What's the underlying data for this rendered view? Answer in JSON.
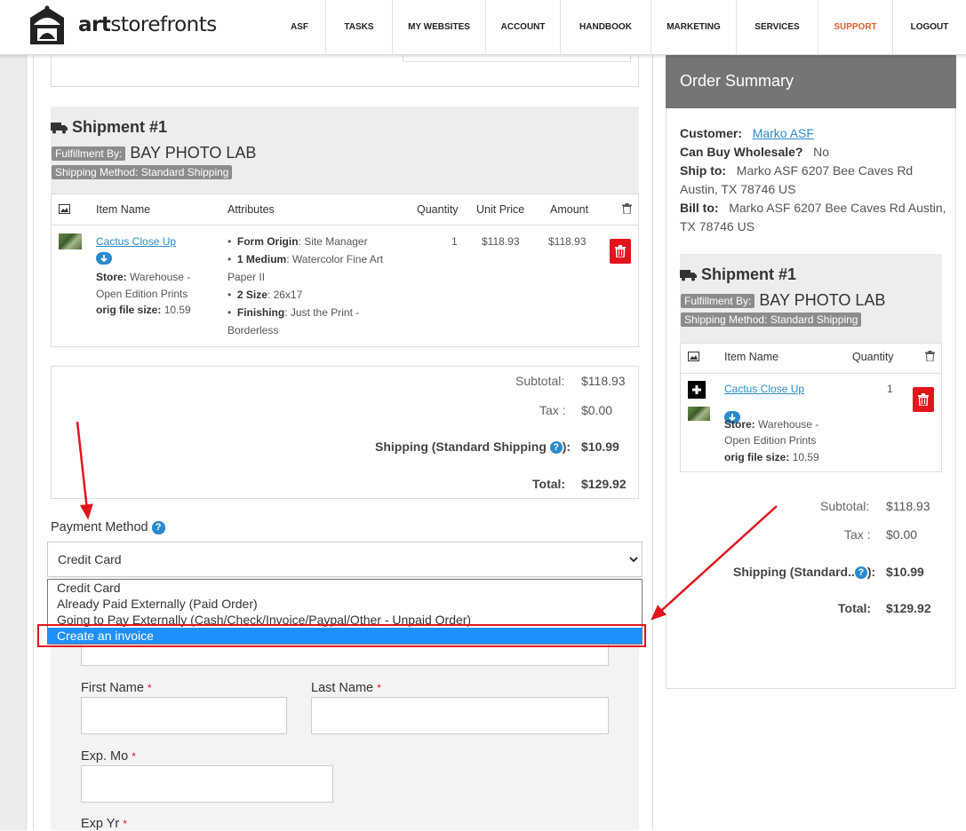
{
  "nav": {
    "logo_part1": "art",
    "logo_part2": "storefronts",
    "items": [
      {
        "label": "ASF"
      },
      {
        "label": "TASKS"
      },
      {
        "label": "MY WEBSITES"
      },
      {
        "label": "ACCOUNT"
      },
      {
        "label": "HANDBOOK"
      },
      {
        "label": "MARKETING"
      },
      {
        "label": "SERVICES"
      },
      {
        "label": "SUPPORT"
      },
      {
        "label": "LOGOUT"
      }
    ],
    "support_color": "#e4602b"
  },
  "shipment": {
    "title": "Shipment #1",
    "fulfillment_tag": "Fulfillment By:",
    "fulfillment_lab": "BAY PHOTO LAB",
    "shipping_method_tag": "Shipping Method: Standard Shipping",
    "columns": {
      "item_name": "Item Name",
      "attributes": "Attributes",
      "quantity": "Quantity",
      "unit_price": "Unit Price",
      "amount": "Amount"
    },
    "item": {
      "name": "Cactus Close Up",
      "store_label": "Store:",
      "store_value": "Warehouse -",
      "store_value2": "Open Edition Prints",
      "orig_label": "orig file size:",
      "orig_value": "10.59",
      "attributes": [
        {
          "key": "Form Origin",
          "value": ": Site Manager"
        },
        {
          "key": "1 Medium",
          "value": ": Watercolor Fine Art"
        },
        {
          "key": "",
          "value": "Paper II"
        },
        {
          "key": "2 Size",
          "value": ": 26x17"
        },
        {
          "key": "Finishing",
          "value": ": Just the Print -"
        },
        {
          "key": "",
          "value": "Borderless"
        }
      ],
      "quantity": "1",
      "unit_price": "$118.93",
      "amount": "$118.93"
    }
  },
  "totals": {
    "subtotal_label": "Subtotal:",
    "subtotal": "$118.93",
    "tax_label": "Tax :",
    "tax": "$0.00",
    "shipping_label": "Shipping (Standard Shipping",
    "shipping_suffix": "):",
    "shipping": "$10.99",
    "total_label": "Total:",
    "total": "$129.92"
  },
  "payment": {
    "label": "Payment Method",
    "selected": "Credit Card",
    "options": [
      "Credit Card",
      "Already Paid Externally (Paid Order)",
      "Going to Pay Externally (Cash/Check/Invoice/Paypal/Other - Unpaid Order)",
      "Create an invoice"
    ],
    "highlight_index": 3
  },
  "form": {
    "first_name": "First Name",
    "last_name": "Last Name",
    "exp_mo": "Exp. Mo",
    "exp_yr": "Exp Yr",
    "required_mark": "*"
  },
  "summary": {
    "title": "Order Summary",
    "customer_label": "Customer:",
    "customer": "Marko ASF",
    "wholesale_label": "Can Buy Wholesale?",
    "wholesale": "No",
    "ship_to_label": "Ship to:",
    "ship_to_line1": "Marko ASF 6207 Bee Caves Rd",
    "ship_to_line2": "Austin, TX 78746 US",
    "bill_to_label": "Bill to:",
    "bill_to_line1": "Marko ASF 6207 Bee Caves Rd Austin,",
    "bill_to_line2": "TX 78746 US",
    "shipment_title": "Shipment #1",
    "fulfillment_tag": "Fulfillment By:",
    "fulfillment_lab": "BAY PHOTO LAB",
    "shipping_method_tag": "Shipping Method: Standard Shipping",
    "col_item": "Item Name",
    "col_qty": "Quantity",
    "item_name": "Cactus Close Up",
    "store_label": "Store:",
    "store_value": "Warehouse -",
    "store_value2": "Open Edition Prints",
    "orig_label": "orig file size:",
    "orig_value": "10.59",
    "quantity": "1",
    "subtotal_label": "Subtotal:",
    "subtotal": "$118.93",
    "tax_label": "Tax :",
    "tax": "$0.00",
    "shipping_label": "Shipping (Standard..",
    "shipping_suffix": "):",
    "shipping": "$10.99",
    "total_label": "Total:",
    "total": "$129.92"
  },
  "annotation_color": "#e3141c",
  "accent_color": "#2a8acb"
}
